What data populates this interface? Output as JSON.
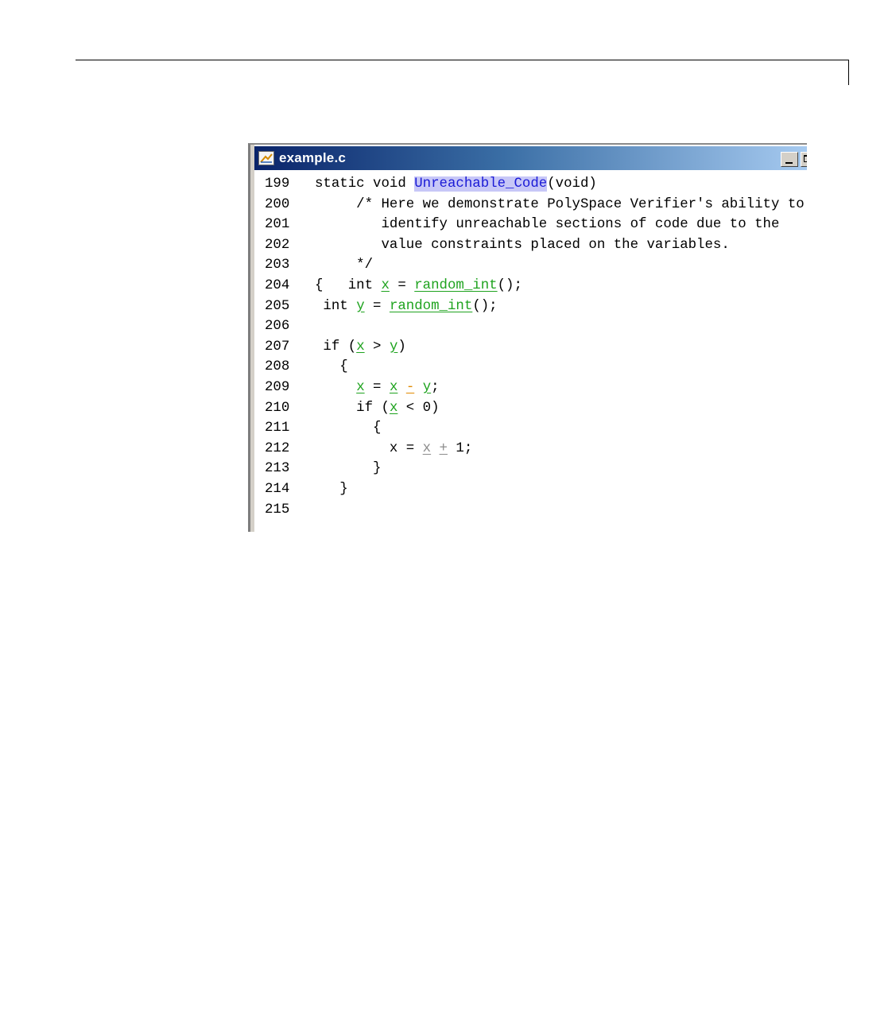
{
  "window": {
    "title": "example.c"
  },
  "code": {
    "lines": [
      {
        "num": "199",
        "segments": [
          {
            "text": "static void ",
            "style": "plain"
          },
          {
            "text": "Unreachable_Code",
            "style": "fn-highlight"
          },
          {
            "text": "(void)",
            "style": "plain"
          }
        ]
      },
      {
        "num": "200",
        "segments": [
          {
            "text": "     /* Here we demonstrate PolySpace Verifier's ability to",
            "style": "plain"
          }
        ]
      },
      {
        "num": "201",
        "segments": [
          {
            "text": "        identify unreachable sections of code due to the",
            "style": "plain"
          }
        ]
      },
      {
        "num": "202",
        "segments": [
          {
            "text": "        value constraints placed on the variables.",
            "style": "plain"
          }
        ]
      },
      {
        "num": "203",
        "segments": [
          {
            "text": "     */",
            "style": "plain"
          }
        ]
      },
      {
        "num": "204",
        "segments": [
          {
            "text": "{   int ",
            "style": "plain"
          },
          {
            "text": "x",
            "style": "green"
          },
          {
            "text": " = ",
            "style": "plain"
          },
          {
            "text": "random_int",
            "style": "green"
          },
          {
            "text": "();",
            "style": "plain"
          }
        ]
      },
      {
        "num": "205",
        "segments": [
          {
            "text": " int ",
            "style": "plain"
          },
          {
            "text": "y",
            "style": "green"
          },
          {
            "text": " = ",
            "style": "plain"
          },
          {
            "text": "random_int",
            "style": "green"
          },
          {
            "text": "();",
            "style": "plain"
          }
        ]
      },
      {
        "num": "206",
        "segments": []
      },
      {
        "num": "207",
        "segments": [
          {
            "text": " if (",
            "style": "plain"
          },
          {
            "text": "x",
            "style": "green"
          },
          {
            "text": " > ",
            "style": "plain"
          },
          {
            "text": "y",
            "style": "green"
          },
          {
            "text": ")",
            "style": "plain"
          }
        ]
      },
      {
        "num": "208",
        "segments": [
          {
            "text": "   {",
            "style": "plain"
          }
        ]
      },
      {
        "num": "209",
        "segments": [
          {
            "text": "     ",
            "style": "plain"
          },
          {
            "text": "x",
            "style": "green"
          },
          {
            "text": " = ",
            "style": "plain"
          },
          {
            "text": "x",
            "style": "green"
          },
          {
            "text": " ",
            "style": "plain"
          },
          {
            "text": "-",
            "style": "orange"
          },
          {
            "text": " ",
            "style": "plain"
          },
          {
            "text": "y",
            "style": "green"
          },
          {
            "text": ";",
            "style": "plain"
          }
        ]
      },
      {
        "num": "210",
        "segments": [
          {
            "text": "     if (",
            "style": "plain"
          },
          {
            "text": "x",
            "style": "green"
          },
          {
            "text": " < 0)",
            "style": "plain"
          }
        ]
      },
      {
        "num": "211",
        "segments": [
          {
            "text": "       {",
            "style": "plain"
          }
        ]
      },
      {
        "num": "212",
        "segments": [
          {
            "text": "         x = ",
            "style": "plain"
          },
          {
            "text": "x",
            "style": "gray"
          },
          {
            "text": " ",
            "style": "plain"
          },
          {
            "text": "+",
            "style": "gray"
          },
          {
            "text": " 1;",
            "style": "plain"
          }
        ]
      },
      {
        "num": "213",
        "segments": [
          {
            "text": "       }",
            "style": "plain"
          }
        ]
      },
      {
        "num": "214",
        "segments": [
          {
            "text": "   }",
            "style": "plain"
          }
        ]
      },
      {
        "num": "215",
        "segments": []
      }
    ]
  },
  "colors": {
    "green_check": "#1fa31f",
    "orange_check": "#e08a00",
    "unreachable_gray": "#8c8c8c",
    "function_highlight": "#c7c7f7",
    "titlebar_start": "#0a246a",
    "titlebar_end": "#a6caf0"
  },
  "icons": {
    "window_icon": "matlab-file-icon",
    "minimize": "minimize-icon",
    "maximize": "maximize-icon"
  }
}
